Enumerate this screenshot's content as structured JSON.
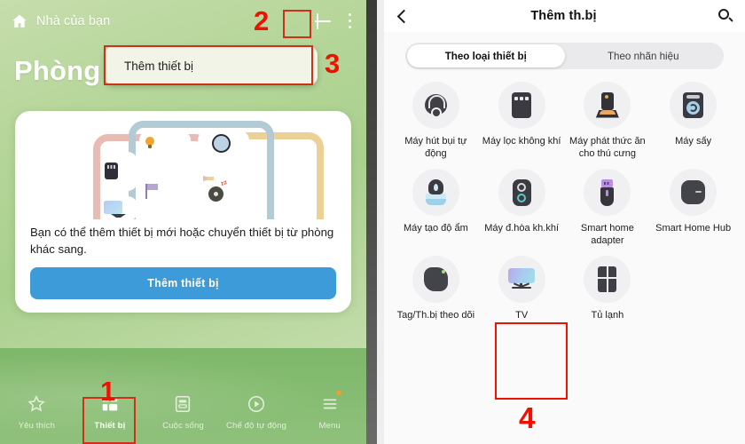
{
  "left_panel": {
    "header": {
      "home_icon": "home-icon",
      "home_label": "Nhà của bạn",
      "add_icon": "plus-icon",
      "more_icon": "kebab-menu-icon"
    },
    "room_title": "Phòng",
    "popup_menu": {
      "items": [
        "Thêm thiết bị"
      ]
    },
    "card": {
      "description": "Bạn có thể thêm thiết bị mới hoặc chuyển thiết bị từ phòng khác sang.",
      "button_label": "Thêm thiết bị",
      "button_color": "#3d9bd9"
    },
    "bottom_nav": [
      {
        "label": "Yêu thích",
        "icon": "star-icon",
        "active": false,
        "badge": false
      },
      {
        "label": "Thiết bị",
        "icon": "devices-grid-icon",
        "active": true,
        "badge": false
      },
      {
        "label": "Cuộc sống",
        "icon": "life-card-icon",
        "active": false,
        "badge": false
      },
      {
        "label": "Chế độ tự động",
        "icon": "play-circle-icon",
        "active": false,
        "badge": false
      },
      {
        "label": "Menu",
        "icon": "hamburger-icon",
        "active": false,
        "badge": true
      }
    ]
  },
  "right_panel": {
    "header": {
      "back_icon": "back-arrow-icon",
      "title": "Thêm th.bị",
      "search_icon": "search-icon"
    },
    "tabs": [
      {
        "label": "Theo loại thiết bị",
        "active": true
      },
      {
        "label": "Theo nhãn hiệu",
        "active": false
      }
    ],
    "devices": [
      {
        "label": "Máy hút bụi tự động",
        "icon": "robot-vacuum-icon",
        "selected": false
      },
      {
        "label": "Máy lọc không khí",
        "icon": "air-purifier-icon",
        "selected": false
      },
      {
        "label": "Máy phát thức ăn cho thú cưng",
        "icon": "pet-feeder-icon",
        "selected": false
      },
      {
        "label": "Máy sấy",
        "icon": "dryer-icon",
        "selected": false
      },
      {
        "label": "Máy tạo độ ẩm",
        "icon": "humidifier-icon",
        "selected": false
      },
      {
        "label": "Máy đ.hòa kh.khí",
        "icon": "air-conditioner-icon",
        "selected": false
      },
      {
        "label": "Smart home adapter",
        "icon": "usb-adapter-icon",
        "selected": false
      },
      {
        "label": "Smart Home Hub",
        "icon": "smart-hub-icon",
        "selected": false
      },
      {
        "label": "Tag/Th.bị theo dõi",
        "icon": "tracker-tag-icon",
        "selected": false
      },
      {
        "label": "TV",
        "icon": "tv-icon",
        "selected": true
      },
      {
        "label": "Tủ lạnh",
        "icon": "refrigerator-icon",
        "selected": false
      }
    ]
  },
  "annotations": {
    "step1": "1",
    "step2": "2",
    "step3": "3",
    "step4": "4",
    "color": "#f01000"
  }
}
